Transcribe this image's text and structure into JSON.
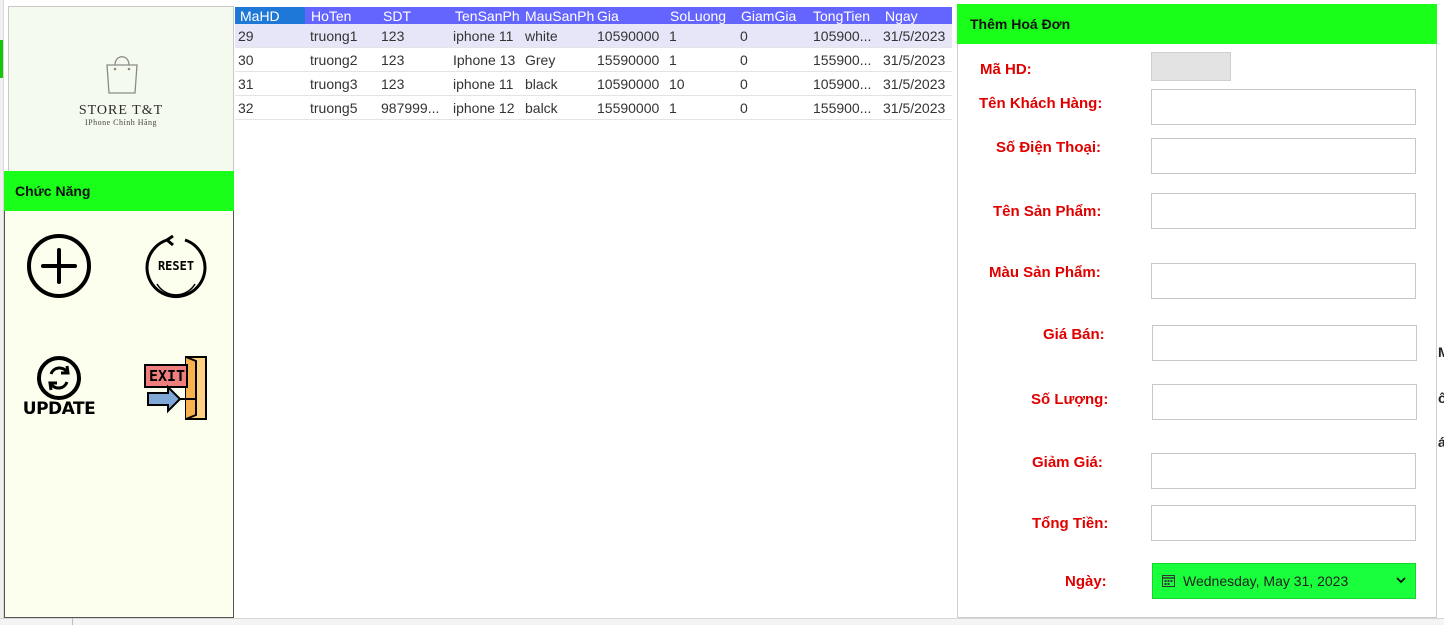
{
  "logo": {
    "title": "STORE T&T",
    "subtitle": "IPhone Chính Hãng"
  },
  "functions": {
    "header": "Chức Năng",
    "add_icon": "plus-circle-icon",
    "reset_label": "RESET",
    "update_label": "UPDATE",
    "exit_label": "EXIT"
  },
  "grid": {
    "columns": [
      "MaHD",
      "HoTen",
      "SDT",
      "TenSanPh",
      "MauSanPh",
      "Gia",
      "SoLuong",
      "GiamGia",
      "TongTien",
      "Ngay"
    ],
    "rows": [
      [
        "29",
        "truong1",
        "123",
        "iphone 11",
        "white",
        "10590000",
        "1",
        "0",
        "105900...",
        "31/5/2023"
      ],
      [
        "30",
        "truong2",
        "123",
        "Iphone 13",
        "Grey",
        "15590000",
        "1",
        "0",
        "155900...",
        "31/5/2023"
      ],
      [
        "31",
        "truong3",
        "123",
        "iphone 11",
        "black",
        "10590000",
        "10",
        "0",
        "105900...",
        "31/5/2023"
      ],
      [
        "32",
        "truong5",
        "987999...",
        "iphone 12",
        "balck",
        "15590000",
        "1",
        "0",
        "155900...",
        "31/5/2023"
      ]
    ]
  },
  "form": {
    "header": "Thêm Hoá Đơn",
    "labels": {
      "mahd": "Mã HD:",
      "ten_kh": "Tên Khách Hàng:",
      "sdt": "Số Điện Thoại:",
      "ten_sp": "Tên Sản Phẩm:",
      "mau_sp": "Màu Sản Phẩm:",
      "gia_ban": "Giá Bán:",
      "so_luong": "Số Lượng:",
      "giam_gia": "Giảm Giá:",
      "tong_tien": "Tổng Tiền:",
      "ngay": "Ngày:"
    },
    "values": {
      "mahd": "",
      "ten_kh": "",
      "sdt": "",
      "ten_sp": "",
      "mau_sp": "",
      "gia_ban": "",
      "so_luong": "",
      "giam_gia": "",
      "tong_tien": ""
    },
    "date_value": "Wednesday, May 31, 2023"
  },
  "clipped_fragments": [
    "M",
    "ố",
    "á"
  ],
  "colors": {
    "accent_green": "#19ff19",
    "grid_header": "#6464ff",
    "label_red": "#e00000",
    "function_panel_bg": "#fcffed"
  }
}
